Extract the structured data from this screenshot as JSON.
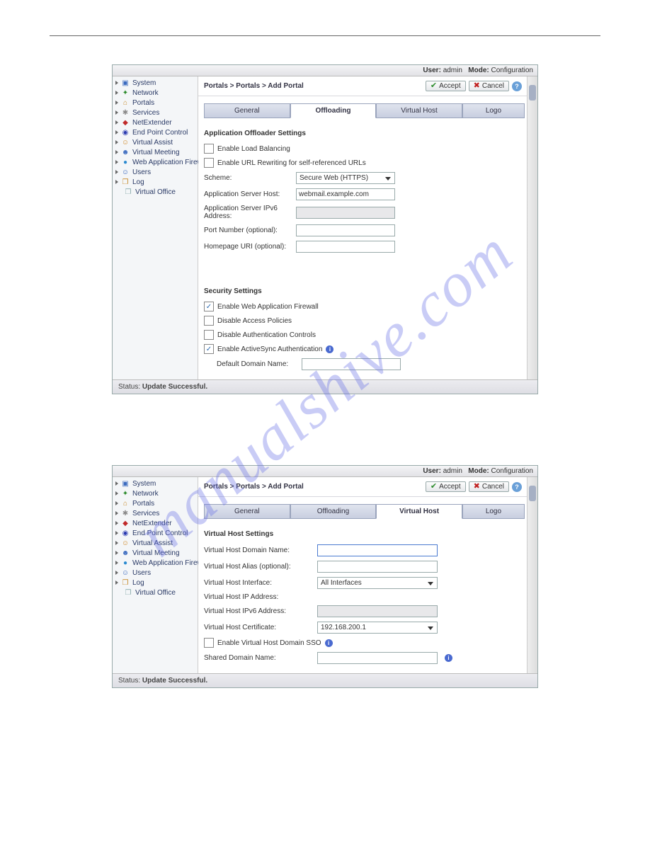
{
  "watermark": "manualshive.com",
  "titlebar": {
    "user_label": "User:",
    "user_value": "admin",
    "mode_label": "Mode:",
    "mode_value": "Configuration"
  },
  "sidebar": {
    "items": [
      {
        "label": "System",
        "icon": "monitor",
        "color": "#3a6abf"
      },
      {
        "label": "Network",
        "icon": "network",
        "color": "#2a8a2a"
      },
      {
        "label": "Portals",
        "icon": "home",
        "color": "#c78a2a"
      },
      {
        "label": "Services",
        "icon": "gear",
        "color": "#8a8a8a"
      },
      {
        "label": "NetExtender",
        "icon": "shield",
        "color": "#c02a2a"
      },
      {
        "label": "End Point Control",
        "icon": "shield2",
        "color": "#2a3ab0"
      },
      {
        "label": "Virtual Assist",
        "icon": "person",
        "color": "#d08a2a"
      },
      {
        "label": "Virtual Meeting",
        "icon": "people",
        "color": "#3a6abf"
      },
      {
        "label": "Web Application Firewall",
        "icon": "globe",
        "color": "#2a8ad0"
      },
      {
        "label": "Users",
        "icon": "user",
        "color": "#3a6abf"
      },
      {
        "label": "Log",
        "icon": "doc",
        "color": "#c78a2a"
      }
    ],
    "child": {
      "label": "Virtual Office",
      "icon": "doc",
      "color": "#8aa"
    }
  },
  "breadcrumb": "Portals > Portals > Add Portal",
  "buttons": {
    "accept": "Accept",
    "cancel": "Cancel"
  },
  "status": {
    "label": "Status:",
    "value": "Update Successful."
  },
  "window1": {
    "tabs": [
      "General",
      "Offloading",
      "Virtual Host",
      "Logo"
    ],
    "active_tab": 1,
    "section1_title": "Application Offloader Settings",
    "chk_load_balancing": {
      "label": "Enable Load Balancing",
      "checked": false
    },
    "chk_url_rewrite": {
      "label": "Enable URL Rewriting for self-referenced URLs",
      "checked": false
    },
    "scheme": {
      "label": "Scheme:",
      "value": "Secure Web (HTTPS)"
    },
    "app_host": {
      "label": "Application Server Host:",
      "value": "webmail.example.com"
    },
    "app_ipv6": {
      "label": "Application Server IPv6 Address:",
      "value": ""
    },
    "port": {
      "label": "Port Number (optional):",
      "value": ""
    },
    "homepage": {
      "label": "Homepage URI (optional):",
      "value": ""
    },
    "section2_title": "Security Settings",
    "chk_waf": {
      "label": "Enable Web Application Firewall",
      "checked": true
    },
    "chk_disable_access": {
      "label": "Disable Access Policies",
      "checked": false
    },
    "chk_disable_auth": {
      "label": "Disable Authentication Controls",
      "checked": false
    },
    "chk_activesync": {
      "label": "Enable ActiveSync Authentication",
      "checked": true
    },
    "default_domain": {
      "label": "Default Domain Name:",
      "value": ""
    }
  },
  "window2": {
    "tabs": [
      "General",
      "Offloading",
      "Virtual Host",
      "Logo"
    ],
    "active_tab": 2,
    "section_title": "Virtual Host Settings",
    "vh_domain": {
      "label": "Virtual Host Domain Name:",
      "value": ""
    },
    "vh_alias": {
      "label": "Virtual Host Alias (optional):",
      "value": ""
    },
    "vh_iface": {
      "label": "Virtual Host Interface:",
      "value": "All Interfaces"
    },
    "vh_ip": {
      "label": "Virtual Host IP Address:",
      "value": ""
    },
    "vh_ipv6": {
      "label": "Virtual Host IPv6 Address:",
      "value": ""
    },
    "vh_cert": {
      "label": "Virtual Host Certificate:",
      "value": "192.168.200.1"
    },
    "chk_sso": {
      "label": "Enable Virtual Host Domain SSO",
      "checked": false
    },
    "shared_domain": {
      "label": "Shared Domain Name:",
      "value": ""
    }
  }
}
